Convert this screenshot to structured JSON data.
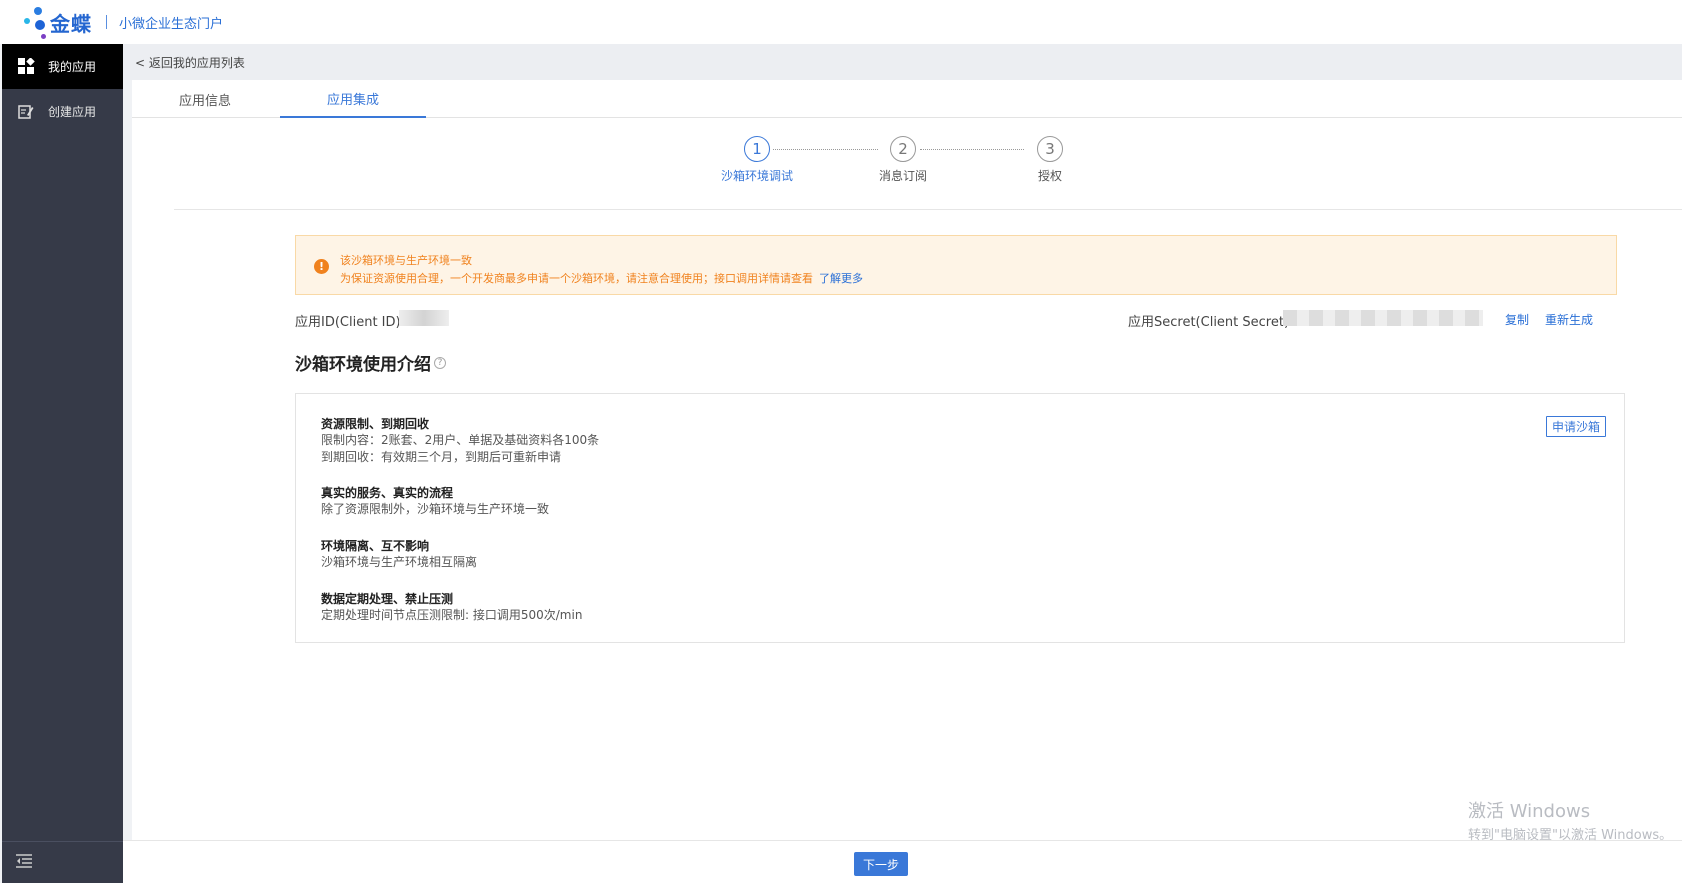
{
  "header": {
    "logo_text": "金蝶",
    "portal_name": "小微企业生态门户"
  },
  "sidebar": {
    "items": [
      {
        "label": "我的应用",
        "icon": "grid-icon",
        "active": true
      },
      {
        "label": "创建应用",
        "icon": "edit-icon",
        "active": false
      }
    ],
    "collapse_icon": "menu-collapse-icon"
  },
  "back_link": "< 返回我的应用列表",
  "tabs": [
    {
      "label": "应用信息",
      "active": false
    },
    {
      "label": "应用集成",
      "active": true
    }
  ],
  "steps": [
    {
      "num": "1",
      "label": "沙箱环境调试",
      "active": true
    },
    {
      "num": "2",
      "label": "消息订阅",
      "active": false
    },
    {
      "num": "3",
      "label": "授权",
      "active": false
    }
  ],
  "alert": {
    "line1": "该沙箱环境与生产环境一致",
    "line2": "为保证资源使用合理，一个开发商最多申请一个沙箱环境，请注意合理使用；接口调用详情请查看",
    "link": "了解更多"
  },
  "credentials": {
    "client_id_label": "应用ID(Client ID)",
    "client_secret_label": "应用Secret(Client Secret)",
    "copy": "复制",
    "regenerate": "重新生成"
  },
  "intro": {
    "title": "沙箱环境使用介绍",
    "help_icon": "?",
    "apply_button": "申请沙箱",
    "items": [
      {
        "heading": "资源限制、到期回收",
        "lines": [
          "限制内容：2账套、2用户、单据及基础资料各100条",
          "到期回收：有效期三个月，到期后可重新申请"
        ]
      },
      {
        "heading": "真实的服务、真实的流程",
        "lines": [
          "除了资源限制外，沙箱环境与生产环境一致"
        ]
      },
      {
        "heading": "环境隔离、互不影响",
        "lines": [
          "沙箱环境与生产环境相互隔离"
        ]
      },
      {
        "heading": "数据定期处理、禁止压测",
        "lines": [
          "定期处理时间节点压测限制: 接口调用500次/min"
        ]
      }
    ]
  },
  "next_button": "下一步",
  "watermark": {
    "line1": "激活 Windows",
    "line2": "转到\"电脑设置\"以激活 Windows。"
  },
  "colors": {
    "primary": "#3a78d8",
    "sidebar_bg": "#363a48",
    "warning": "#f0821e"
  }
}
